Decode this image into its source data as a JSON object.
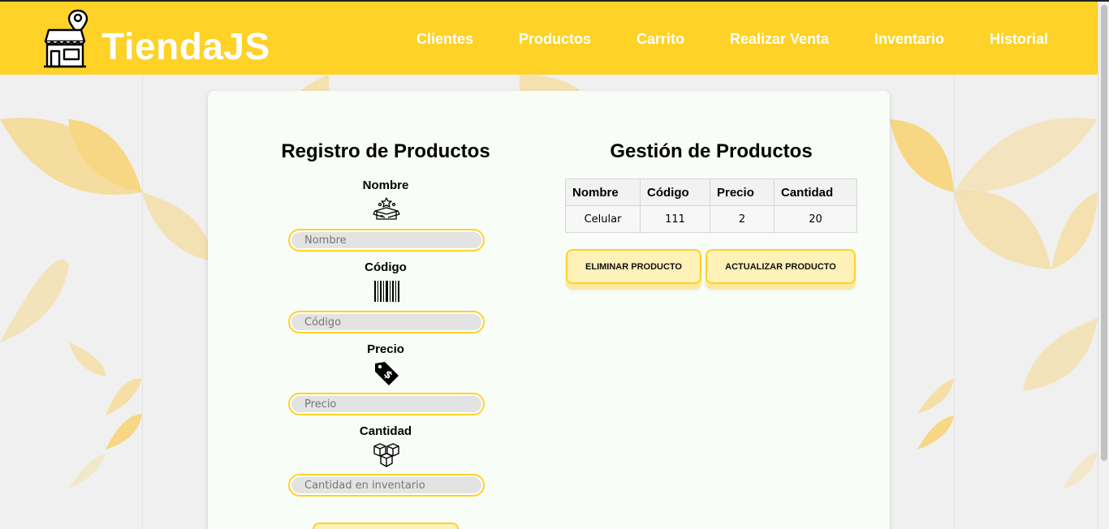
{
  "app": {
    "brand": "TiendaJS"
  },
  "nav": {
    "items": [
      "Clientes",
      "Productos",
      "Carrito",
      "Realizar Venta",
      "Inventario",
      "Historial"
    ]
  },
  "registro": {
    "title": "Registro de Productos",
    "fields": [
      {
        "label": "Nombre",
        "placeholder": "Nombre",
        "icon": "product-box-icon"
      },
      {
        "label": "Código",
        "placeholder": "Código",
        "icon": "barcode-icon"
      },
      {
        "label": "Precio",
        "placeholder": "Precio",
        "icon": "price-tag-icon"
      },
      {
        "label": "Cantidad",
        "placeholder": "Cantidad en inventario",
        "icon": "boxes-icon"
      }
    ]
  },
  "gestion": {
    "title": "Gestión de Productos",
    "table": {
      "headers": [
        "Nombre",
        "Código",
        "Precio",
        "Cantidad"
      ],
      "rows": [
        [
          "Celular",
          "111",
          "2",
          "20"
        ]
      ]
    },
    "buttons": {
      "delete": "ELIMINAR PRODUCTO",
      "update": "ACTUALIZAR PRODUCTO"
    }
  },
  "colors": {
    "accent": "#fed226",
    "button_bg": "#fff1b8",
    "card_bg": "#f8fdf7"
  }
}
